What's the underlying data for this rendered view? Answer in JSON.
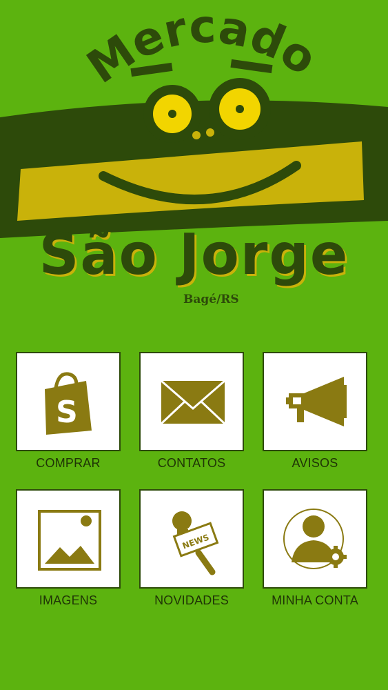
{
  "header": {
    "logo_word_top": "Mercado",
    "logo_word_main": "São Jorge",
    "logo_city": "Bagé/RS"
  },
  "menu": {
    "items": [
      {
        "label": "COMPRAR",
        "icon": "shopping-bag-icon"
      },
      {
        "label": "CONTATOS",
        "icon": "envelope-icon"
      },
      {
        "label": "AVISOS",
        "icon": "megaphone-icon"
      },
      {
        "label": "IMAGENS",
        "icon": "image-icon"
      },
      {
        "label": "NOVIDADES",
        "icon": "news-microphone-icon"
      },
      {
        "label": "MINHA CONTA",
        "icon": "user-settings-icon"
      }
    ]
  },
  "colors": {
    "background": "#5cb30f",
    "logo_dark": "#2d4a0a",
    "logo_gold": "#c9b20a",
    "eye_yellow": "#f2d500",
    "icon_olive": "#8a7a12",
    "tile_border": "#2d4a0a"
  }
}
